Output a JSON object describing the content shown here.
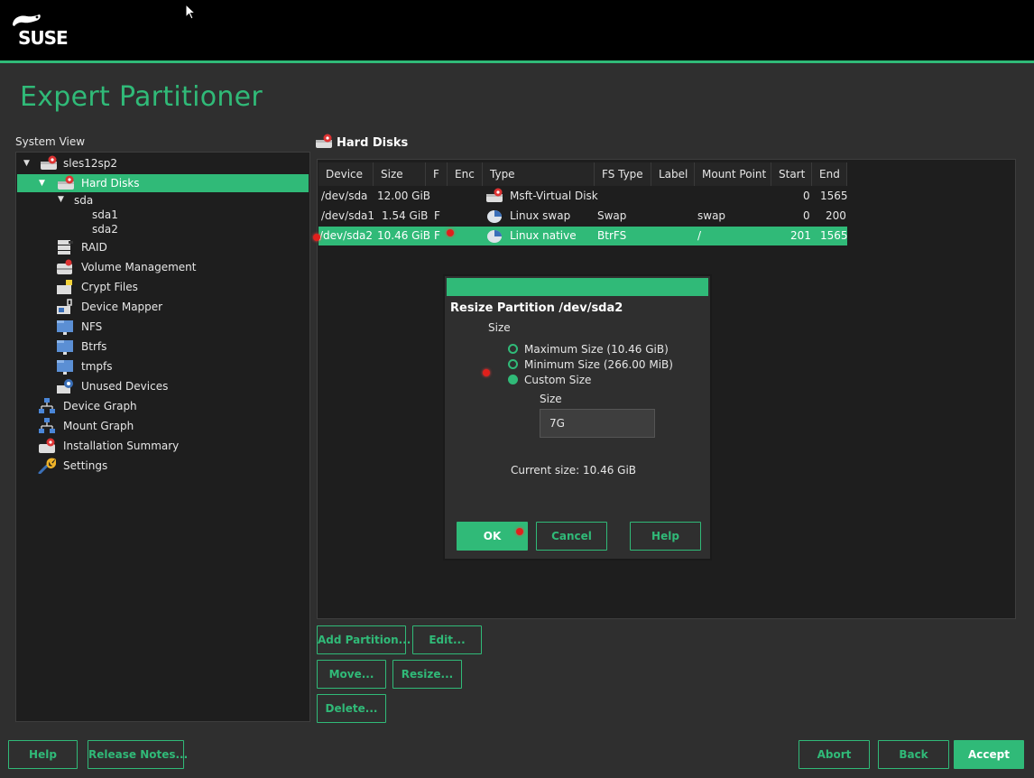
{
  "brand": {
    "logo_text": "SUSE"
  },
  "page": {
    "title": "Expert Partitioner",
    "accent_color": "#30ba78"
  },
  "system_view": {
    "label": "System View",
    "tree": [
      {
        "label": "sles12sp2",
        "icon": "hard-disk-icon"
      },
      {
        "label": "Hard Disks",
        "icon": "hard-disk-icon",
        "selected": true
      },
      {
        "label": "sda"
      },
      {
        "label": "sda1"
      },
      {
        "label": "sda2"
      },
      {
        "label": "RAID",
        "icon": "raid-icon"
      },
      {
        "label": "Volume Management",
        "icon": "volume-icon"
      },
      {
        "label": "Crypt Files",
        "icon": "crypt-icon"
      },
      {
        "label": "Device Mapper",
        "icon": "device-mapper-icon"
      },
      {
        "label": "NFS",
        "icon": "nfs-icon"
      },
      {
        "label": "Btrfs",
        "icon": "btrfs-icon"
      },
      {
        "label": "tmpfs",
        "icon": "tmpfs-icon"
      },
      {
        "label": "Unused Devices",
        "icon": "unused-devices-icon"
      },
      {
        "label": "Device Graph",
        "icon": "graph-icon"
      },
      {
        "label": "Mount Graph",
        "icon": "graph-icon"
      },
      {
        "label": "Installation Summary",
        "icon": "summary-icon"
      },
      {
        "label": "Settings",
        "icon": "wrench-icon"
      }
    ]
  },
  "hard_disks": {
    "title": "Hard Disks",
    "columns": [
      "Device",
      "Size",
      "F",
      "Enc",
      "Type",
      "FS Type",
      "Label",
      "Mount Point",
      "Start",
      "End"
    ],
    "rows": [
      {
        "device": "/dev/sda",
        "size": "12.00 GiB",
        "f": "",
        "enc": "",
        "type": "Msft-Virtual Disk",
        "fs_type": "",
        "label": "",
        "mount": "",
        "start": "0",
        "end": "1565"
      },
      {
        "device": "/dev/sda1",
        "size": "1.54 GiB",
        "f": "F",
        "enc": "",
        "type": "Linux swap",
        "fs_type": "Swap",
        "label": "",
        "mount": "swap",
        "start": "0",
        "end": "200"
      },
      {
        "device": "/dev/sda2",
        "size": "10.46 GiB",
        "f": "F",
        "enc": "",
        "type": "Linux native",
        "fs_type": "BtrFS",
        "label": "",
        "mount": "/",
        "start": "201",
        "end": "1565",
        "selected": true
      }
    ],
    "buttons": {
      "add": "Add Partition...",
      "edit": "Edit...",
      "move": "Move...",
      "resize": "Resize...",
      "delete": "Delete..."
    }
  },
  "resize_dialog": {
    "title": "Resize Partition /dev/sda2",
    "size_group_label": "Size",
    "options": [
      {
        "label": "Maximum Size (10.46 GiB)",
        "checked": false
      },
      {
        "label": "Minimum Size (266.00 MiB)",
        "checked": false
      },
      {
        "label": "Custom Size",
        "checked": true
      }
    ],
    "custom_size_label": "Size",
    "custom_size_value": "7G",
    "current_size": "Current size: 10.46 GiB",
    "ok": "OK",
    "cancel": "Cancel",
    "help": "Help"
  },
  "footer": {
    "help": "Help",
    "release_notes": "Release Notes...",
    "abort": "Abort",
    "back": "Back",
    "accept": "Accept"
  }
}
